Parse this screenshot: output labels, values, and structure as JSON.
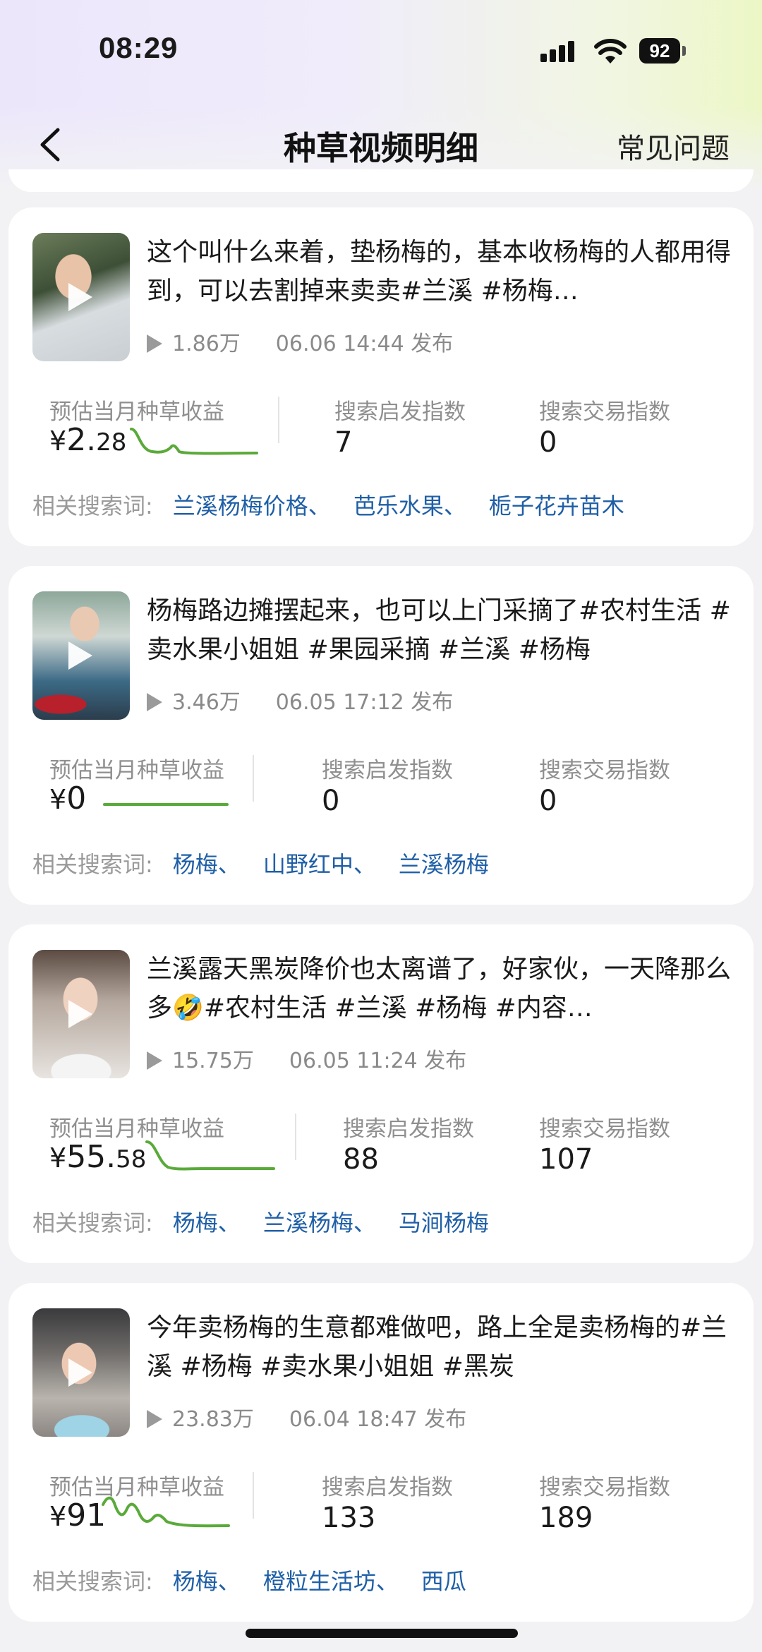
{
  "status_bar": {
    "time": "08:29",
    "battery": "92"
  },
  "nav": {
    "title": "种草视频明细",
    "faq": "常见问题"
  },
  "metric_labels": {
    "income": "预估当月种草收益",
    "search_inspire": "搜索启发指数",
    "search_trade": "搜索交易指数",
    "keywords": "相关搜索词:"
  },
  "colors": {
    "accent_blue": "#1f5fa6",
    "trend_green": "#5aaa3a"
  },
  "videos": [
    {
      "title": "这个叫什么来着，垫杨梅的，基本收杨梅的人都用得到，可以去割掉来卖卖#兰溪 #杨梅…",
      "views": "1.86万",
      "date": "06.06 14:44 发布",
      "income_currency": "¥",
      "income_int": "2.",
      "income_dec": "28",
      "search_inspire": "7",
      "search_trade": "0",
      "keywords": [
        "兰溪杨梅价格、",
        "芭乐水果、",
        "栀子花卉苗木"
      ]
    },
    {
      "title": "杨梅路边摊摆起来，也可以上门采摘了#农村生活 #卖水果小姐姐 #果园采摘 #兰溪 #杨梅",
      "views": "3.46万",
      "date": "06.05 17:12 发布",
      "income_currency": "¥",
      "income_int": "0",
      "income_dec": "",
      "search_inspire": "0",
      "search_trade": "0",
      "keywords": [
        "杨梅、",
        "山野红中、",
        "兰溪杨梅"
      ]
    },
    {
      "title": "兰溪露天黑炭降价也太离谱了，好家伙，一天降那么多🤣#农村生活 #兰溪 #杨梅 #内容…",
      "views": "15.75万",
      "date": "06.05 11:24 发布",
      "income_currency": "¥",
      "income_int": "55.",
      "income_dec": "58",
      "search_inspire": "88",
      "search_trade": "107",
      "keywords": [
        "杨梅、",
        "兰溪杨梅、",
        "马涧杨梅"
      ]
    },
    {
      "title": "今年卖杨梅的生意都难做吧，路上全是卖杨梅的#兰溪 #杨梅 #卖水果小姐姐 #黑炭",
      "views": "23.83万",
      "date": "06.04 18:47 发布",
      "income_currency": "¥",
      "income_int": "91",
      "income_dec": "",
      "search_inspire": "133",
      "search_trade": "189",
      "keywords": [
        "杨梅、",
        "橙粒生活坊、",
        "西瓜"
      ]
    }
  ]
}
